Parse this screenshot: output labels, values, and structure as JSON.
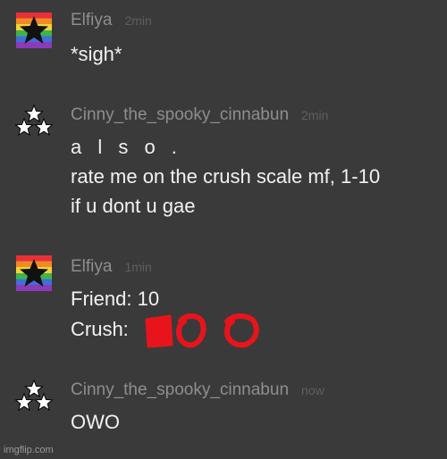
{
  "messages": [
    {
      "author": "Elfiya",
      "time": "2min",
      "avatar": "rainbow-star-avatar",
      "lines": [
        "*sigh*"
      ]
    },
    {
      "author": "Cinny_the_spooky_cinnabun",
      "time": "2min",
      "avatar": "three-stars-avatar",
      "lines": [
        "a l s o .",
        "rate me on the crush scale mf, 1-10",
        "if u dont u gae"
      ]
    },
    {
      "author": "Elfiya",
      "time": "1min",
      "avatar": "rainbow-star-avatar",
      "lines": [
        "Friend: 10",
        "Crush:"
      ]
    },
    {
      "author": "Cinny_the_spooky_cinnabun",
      "time": "now",
      "avatar": "three-stars-avatar",
      "lines": [
        "OWO"
      ]
    }
  ],
  "watermark": "imgflip.com",
  "colors": {
    "background": "#3a3a3a",
    "username": "#8e8e8e",
    "timestamp": "#5f5f5f",
    "message_text": "#f2f2f2",
    "scribble": "#e8141c"
  }
}
